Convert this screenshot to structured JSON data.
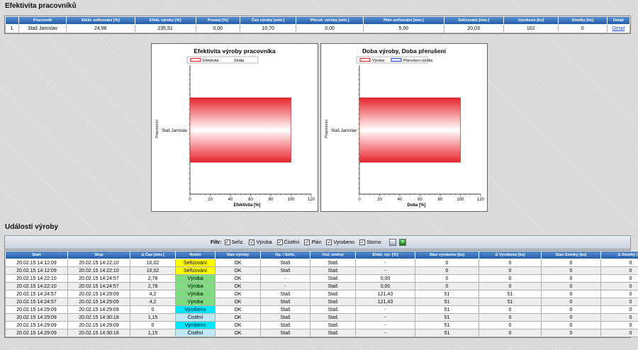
{
  "workers_section": {
    "title": "Efektivita pracovníků",
    "headers": [
      "",
      "Pracovník",
      "Efekt. seřizování [%]",
      "Efekt. výroby [%]",
      "Prostoj [%]",
      "Čas výroby [min.]",
      "Přeruš. výroby [min.]",
      "Plán seřizování [min.]",
      "Seřizování [min.]",
      "Vyrobeno [ks]",
      "Zmetky [ks]",
      "Detail"
    ],
    "rows": [
      {
        "index": "1.",
        "name": "Staš Jaroslav",
        "eff_setup": "24,96",
        "eff_prod": "235,51",
        "downtime": "0,00",
        "prod_time": "10,70",
        "interrupt": "0,00",
        "setup_plan": "5,00",
        "setup": "20,03",
        "produced": "102",
        "scrap": "0",
        "detail": "Detail"
      }
    ]
  },
  "charts": [
    {
      "type": "bar",
      "title": "Efektivita výroby pracovníka",
      "legend": [
        "Efektivita",
        "Ztráta"
      ],
      "legend_colors": [
        "#e8242c",
        "#ffffff"
      ],
      "ylabel": "Pracovníci",
      "xlabel": "Efektivita [%]",
      "categories": [
        "Staš Jaroslav"
      ],
      "values": [
        100
      ],
      "xlim": [
        0,
        120
      ],
      "ticks": [
        "0",
        "20",
        "40",
        "60",
        "80",
        "100",
        "120"
      ]
    },
    {
      "type": "bar",
      "title": "Doba výroby, Doba přerušení",
      "legend": [
        "Výroba",
        "Přerušení výroby"
      ],
      "legend_colors": [
        "#e8242c",
        "#2a4fd8"
      ],
      "ylabel": "Pracovníci",
      "xlabel": "Doba [%]",
      "categories": [
        "Staš Jaroslav"
      ],
      "values": [
        100
      ],
      "xlim": [
        0,
        120
      ],
      "ticks": [
        "0",
        "20",
        "40",
        "60",
        "80",
        "100",
        "120"
      ]
    }
  ],
  "events_section": {
    "title": "Události výroby",
    "filter": {
      "label": "Filtr:",
      "items": [
        {
          "label": "Seřiz.",
          "checked": true
        },
        {
          "label": "Výroba",
          "checked": true
        },
        {
          "label": "Čistění",
          "checked": true
        },
        {
          "label": "Plán",
          "checked": true
        },
        {
          "label": "Vyrobeno",
          "checked": true
        },
        {
          "label": "Storno",
          "checked": true
        }
      ]
    },
    "headers": [
      "Start",
      "Stop",
      "Δ Čas [min.]",
      "Režim",
      "Stav výroby",
      "Op. / Seřiz.",
      "Ved. směny",
      "Efekt. vyr. [%]",
      "Stav vyrobeno [ks]",
      "Δ Vyrobeno [ks]",
      "Stav Zmetky [ks]",
      "Δ Zmetky [ks]"
    ],
    "rows": [
      [
        "20.02.15 14:12:09",
        "20.02.15 14:22:10",
        "10,02",
        "Seřizování",
        "OK",
        "Staš",
        "Staš",
        "-",
        "0",
        "0",
        "0",
        "0"
      ],
      [
        "20.02.15 14:12:09",
        "20.02.15 14:22:10",
        "10,02",
        "Seřizování",
        "OK",
        "Staš",
        "Staš",
        "-",
        "0",
        "0",
        "0",
        "0"
      ],
      [
        "20.02.15 14:22:10",
        "20.02.15 14:24:57",
        "2,78",
        "Výroba",
        "OK",
        "-",
        "Staš",
        "0,00",
        "0",
        "0",
        "0",
        "0"
      ],
      [
        "20.02.15 14:22:10",
        "20.02.15 14:24:57",
        "2,78",
        "Výroba",
        "OK",
        "-",
        "Staš",
        "0,00",
        "0",
        "0",
        "0",
        "0"
      ],
      [
        "20.02.15 14:24:57",
        "20.02.15 14:29:09",
        "4,2",
        "Výroba",
        "OK",
        "Staš",
        "Staš",
        "121,43",
        "51",
        "51",
        "0",
        "0"
      ],
      [
        "20.02.15 14:24:57",
        "20.02.15 14:29:09",
        "4,2",
        "Výroba",
        "OK",
        "Staš",
        "Staš",
        "121,43",
        "51",
        "51",
        "0",
        "0"
      ],
      [
        "20.02.15 14:29:09",
        "20.02.15 14:29:09",
        "0",
        "Vyrobeno",
        "OK",
        "Staš",
        "Staš",
        "-",
        "51",
        "0",
        "0",
        "0"
      ],
      [
        "20.02.15 14:29:09",
        "20.02.15 14:30:18",
        "1,15",
        "Čistění",
        "OK",
        "Staš",
        "Staš",
        "-",
        "51",
        "0",
        "0",
        "0"
      ],
      [
        "20.02.15 14:29:09",
        "20.02.15 14:29:09",
        "0",
        "Vyrobeno",
        "OK",
        "Staš",
        "Staš",
        "-",
        "51",
        "0",
        "0",
        "0"
      ],
      [
        "20.02.15 14:29:09",
        "20.02.15 14:30:18",
        "1,15",
        "Čistění",
        "OK",
        "Staš",
        "Staš",
        "-",
        "51",
        "0",
        "0",
        "0"
      ]
    ]
  }
}
